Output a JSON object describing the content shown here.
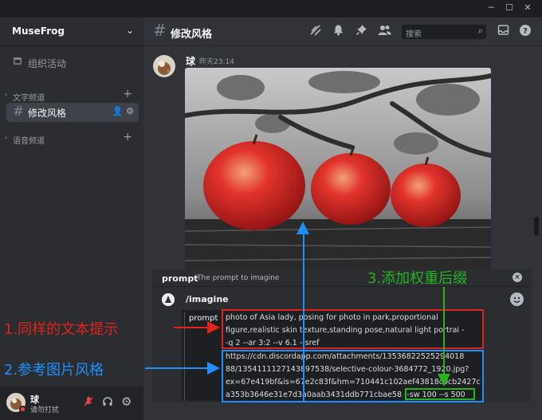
{
  "server": {
    "name": "MuseFrog"
  },
  "sidebar": {
    "events_label": "组织活动",
    "text_category": "文字频道",
    "voice_category": "语音频道",
    "channel": "修改风格"
  },
  "user": {
    "name": "球",
    "status": "请勿打扰"
  },
  "header": {
    "channel_title": "修改风格",
    "search_placeholder": "搜索"
  },
  "message": {
    "author": "球",
    "timestamp": "昨天23:14"
  },
  "command": {
    "option_name": "prompt",
    "option_desc": "The prompt to imagine",
    "name": "/imagine",
    "param_chip": "prompt",
    "lines": [
      "photo of Asia lady, posing for photo in park,proportional",
      "figure,realistic skin texture,standing pose,natural light portrai -",
      "-q 2 --ar 3:2 --v 6.1 --sref",
      "https://cdn.discordapp.com/attachments/13536822525294018",
      "88/1354111127143897538/selective-colour-3684772_1920.jpg?",
      "ex=67e419bf&is=67e2c83f&hm=710441c102aef43818c0cb2427c",
      "a353b3646e31e7d3a0aab3431ddb771cbae58 --sw 100 --s 500"
    ]
  },
  "annotations": {
    "a1": "1.同样的文本提示",
    "a2": "2.参考图片风格",
    "a3": "3.添加权重后缀"
  },
  "colors": {
    "red": "#e0241b",
    "blue": "#1f8fff",
    "green": "#26b31d"
  }
}
